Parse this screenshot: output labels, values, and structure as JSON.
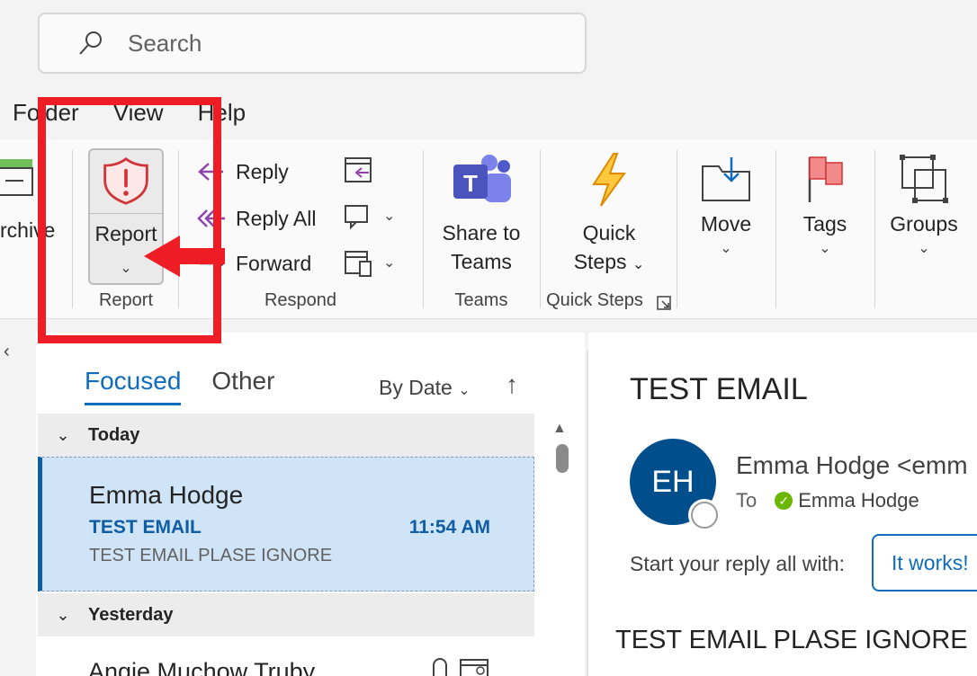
{
  "search": {
    "placeholder": "Search"
  },
  "menu": [
    "Folder",
    "View",
    "Help"
  ],
  "ribbon": {
    "archive_label": "rchive",
    "report": {
      "button_label": "Report",
      "group_label": "Report"
    },
    "respond": {
      "reply": "Reply",
      "reply_all": "Reply All",
      "forward": "Forward",
      "group_label": "Respond"
    },
    "teams": {
      "line1": "Share to",
      "line2": "Teams",
      "group_label": "Teams"
    },
    "quick_steps": {
      "line1": "Quick",
      "line2": "Steps",
      "group_label": "Quick Steps"
    },
    "move": {
      "label": "Move"
    },
    "tags": {
      "label": "Tags"
    },
    "groups": {
      "label": "Groups"
    }
  },
  "list": {
    "tabs": {
      "focused": "Focused",
      "other": "Other"
    },
    "sort_label": "By Date",
    "groups": {
      "today": "Today",
      "yesterday": "Yesterday"
    },
    "selected_mail": {
      "from": "Emma Hodge",
      "subject": "TEST EMAIL",
      "time": "11:54 AM",
      "preview": "TEST EMAIL PLASE IGNORE"
    },
    "next_mail": {
      "from": "Angie Muchow Truby"
    }
  },
  "reading": {
    "subject": "TEST EMAIL",
    "avatar_initials": "EH",
    "sender": "Emma Hodge <emm",
    "to_label": "To",
    "to_name": "Emma Hodge",
    "reply_prompt": "Start your reply all with:",
    "reply_suggestion": "It works!",
    "body": "TEST EMAIL PLASE IGNORE"
  },
  "colors": {
    "accent": "#0f6cbd",
    "annotation_red": "#ee1c25",
    "selected_bg": "#cfe4f7",
    "avatar_bg": "#004e8c"
  }
}
